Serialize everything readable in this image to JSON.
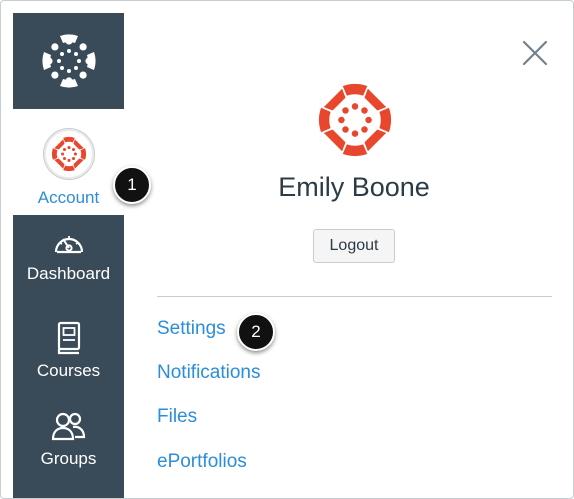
{
  "global_nav": {
    "logo_icon": "canvas-logo-icon",
    "items": [
      {
        "label": "Account",
        "icon": "account-avatar-icon",
        "active": true
      },
      {
        "label": "Dashboard",
        "icon": "dashboard-gauge-icon"
      },
      {
        "label": "Courses",
        "icon": "courses-book-icon"
      },
      {
        "label": "Groups",
        "icon": "groups-people-icon"
      }
    ]
  },
  "callouts": [
    "1",
    "2"
  ],
  "tray": {
    "close_icon": "close-icon",
    "user_name": "Emily Boone",
    "logout_label": "Logout",
    "links": [
      "Settings",
      "Notifications",
      "Files",
      "ePortfolios"
    ]
  },
  "colors": {
    "nav_background": "#394b58",
    "link_blue": "#2b8ed8",
    "logo_red": "#e8472d",
    "text_dark": "#2d3b45"
  }
}
